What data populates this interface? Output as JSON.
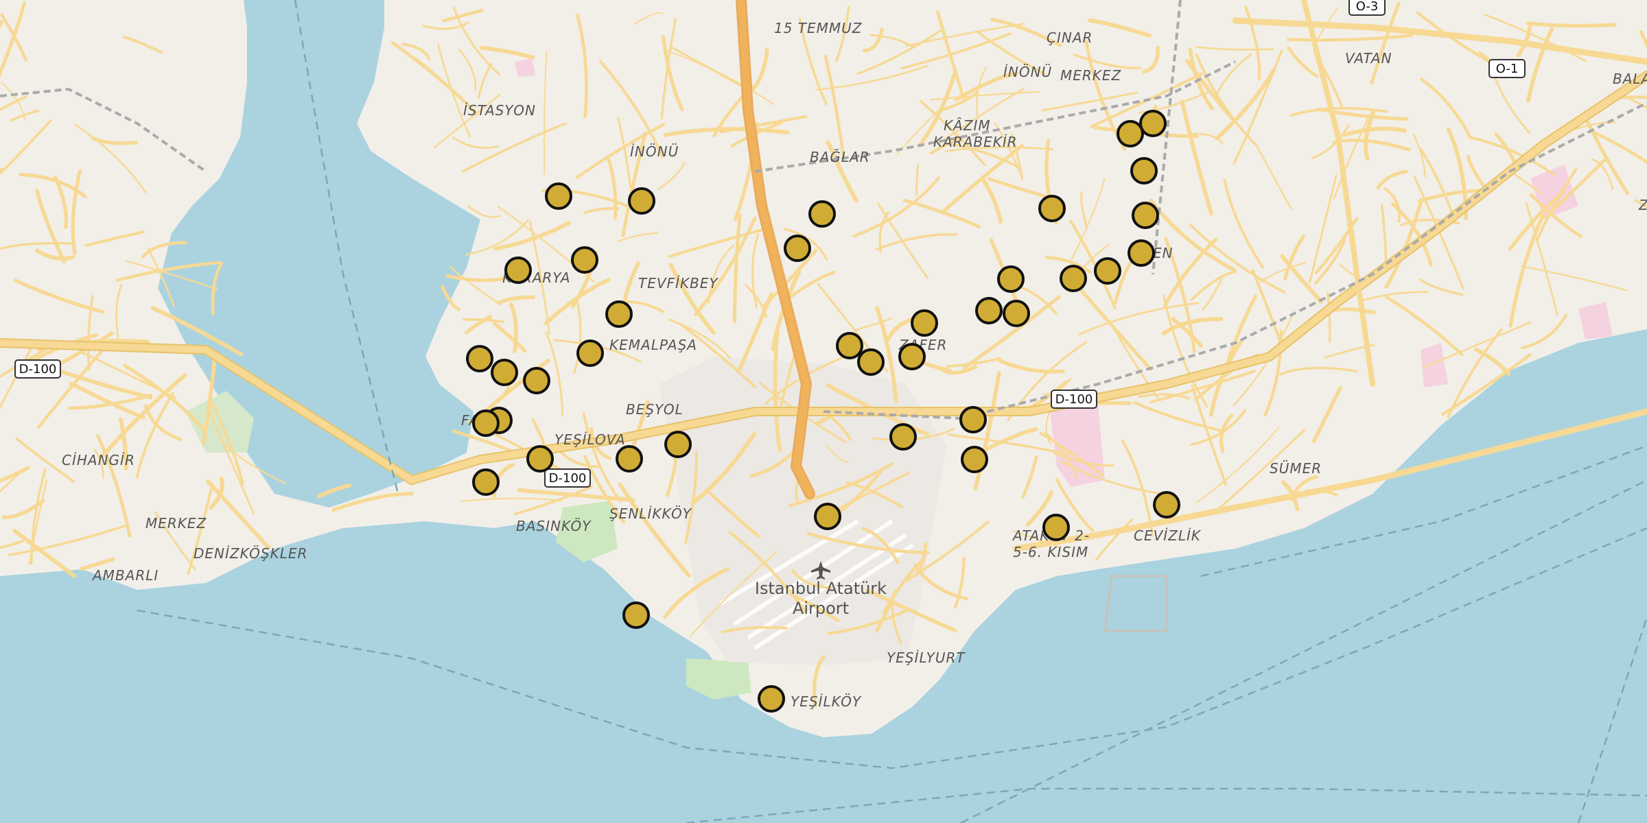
{
  "map": {
    "colors": {
      "land": "#f2efe9",
      "water": "#aad3df",
      "road": "#f7d994",
      "road_casing": "#e8c26a",
      "motorway": "#f0b35c",
      "marker_fill": "#d1ac35",
      "marker_stroke": "#111111",
      "park": "#cde8c0",
      "industrial": "#f5d2e0"
    },
    "place_labels": [
      "15 TEMMUZ",
      "ÇINAR",
      "VATAN",
      "İNÖNÜ",
      "MERKEZ",
      "İSTASYON",
      "KÂZIM",
      "KARABEKİR",
      "İNÖNÜ",
      "BAĞLAR",
      "TEVFİKBEY",
      "KEMALPAŞA",
      "ZAFER",
      "BEŞYOL",
      "YEŞİLOVA",
      "FA",
      "CİHANGİR",
      "MERKEZ",
      "DENİZKÖŞKLER",
      "AMBARLI",
      "BASINKÖY",
      "ŞENLİKKÖY",
      "SÜMER",
      "CEVİZLİK",
      "YEŞİLYURT",
      "YEŞİLKÖY",
      "ATAKÖY 2-",
      "5-6. KISIM",
      "KARARYA",
      "EN",
      "BALA",
      "Z"
    ],
    "road_shields": [
      "O-3",
      "O-1",
      "D-100",
      "D-100",
      "D-100"
    ],
    "airport": {
      "name_line1": "Istanbul Atatürk",
      "name_line2": "Airport",
      "icon": "airplane-icon"
    },
    "marker_count": 44
  }
}
